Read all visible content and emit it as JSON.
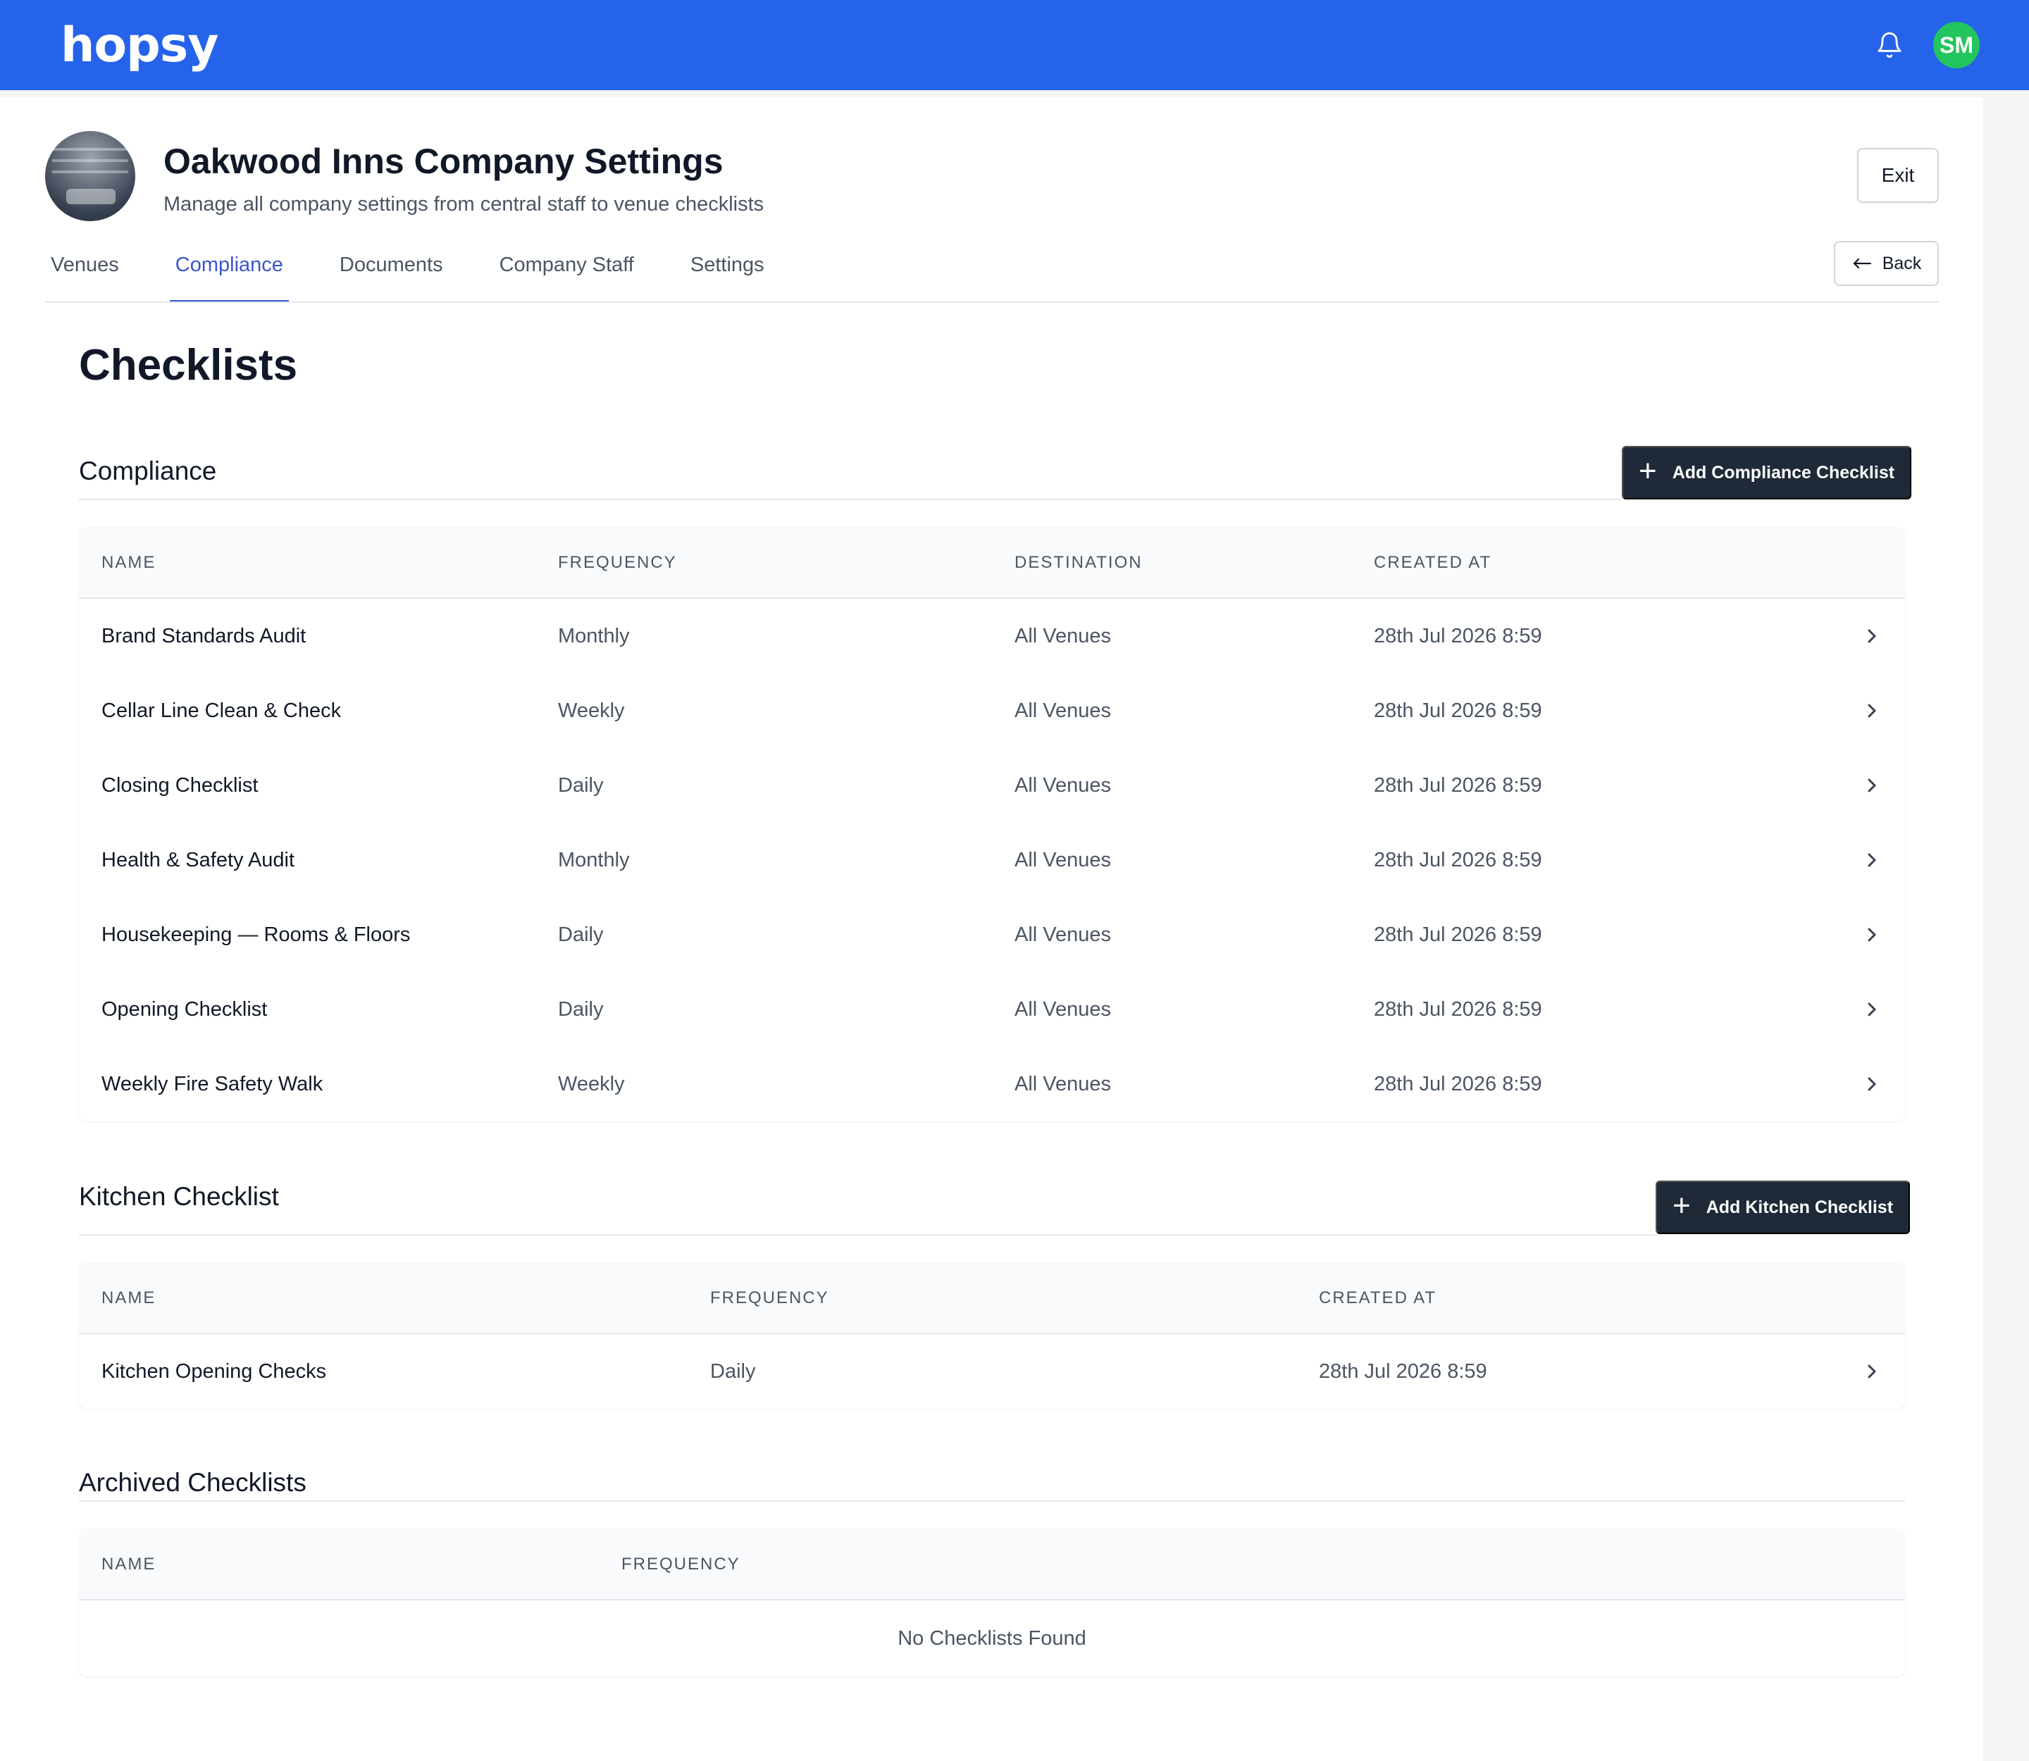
{
  "app": {
    "logo_text": "hopsy",
    "avatar_initials": "SM",
    "brand_color": "#2563eb",
    "avatar_color": "#22c55e"
  },
  "header": {
    "title": "Oakwood Inns Company Settings",
    "subtitle": "Manage all company settings from central staff to venue checklists",
    "exit_label": "Exit",
    "back_label": "Back"
  },
  "tabs": [
    {
      "label": "Venues",
      "active": false
    },
    {
      "label": "Compliance",
      "active": true
    },
    {
      "label": "Documents",
      "active": false
    },
    {
      "label": "Company Staff",
      "active": false
    },
    {
      "label": "Settings",
      "active": false
    }
  ],
  "page_heading": "Checklists",
  "compliance": {
    "title": "Compliance",
    "add_label": "Add Compliance Checklist",
    "columns": [
      "NAME",
      "FREQUENCY",
      "DESTINATION",
      "CREATED AT"
    ],
    "rows": [
      {
        "name": "Brand Standards Audit",
        "frequency": "Monthly",
        "destination": "All Venues",
        "created": "28th Jul 2026 8:59"
      },
      {
        "name": "Cellar Line Clean & Check",
        "frequency": "Weekly",
        "destination": "All Venues",
        "created": "28th Jul 2026 8:59"
      },
      {
        "name": "Closing Checklist",
        "frequency": "Daily",
        "destination": "All Venues",
        "created": "28th Jul 2026 8:59"
      },
      {
        "name": "Health & Safety Audit",
        "frequency": "Monthly",
        "destination": "All Venues",
        "created": "28th Jul 2026 8:59"
      },
      {
        "name": "Housekeeping — Rooms & Floors",
        "frequency": "Daily",
        "destination": "All Venues",
        "created": "28th Jul 2026 8:59"
      },
      {
        "name": "Opening Checklist",
        "frequency": "Daily",
        "destination": "All Venues",
        "created": "28th Jul 2026 8:59"
      },
      {
        "name": "Weekly Fire Safety Walk",
        "frequency": "Weekly",
        "destination": "All Venues",
        "created": "28th Jul 2026 8:59"
      }
    ]
  },
  "kitchen": {
    "title": "Kitchen Checklist",
    "add_label": "Add Kitchen Checklist",
    "columns": [
      "NAME",
      "FREQUENCY",
      "CREATED AT"
    ],
    "rows": [
      {
        "name": "Kitchen Opening Checks",
        "frequency": "Daily",
        "created": "28th Jul 2026 8:59"
      }
    ]
  },
  "archived": {
    "title": "Archived Checklists",
    "columns": [
      "NAME",
      "FREQUENCY"
    ],
    "empty_text": "No Checklists Found"
  }
}
